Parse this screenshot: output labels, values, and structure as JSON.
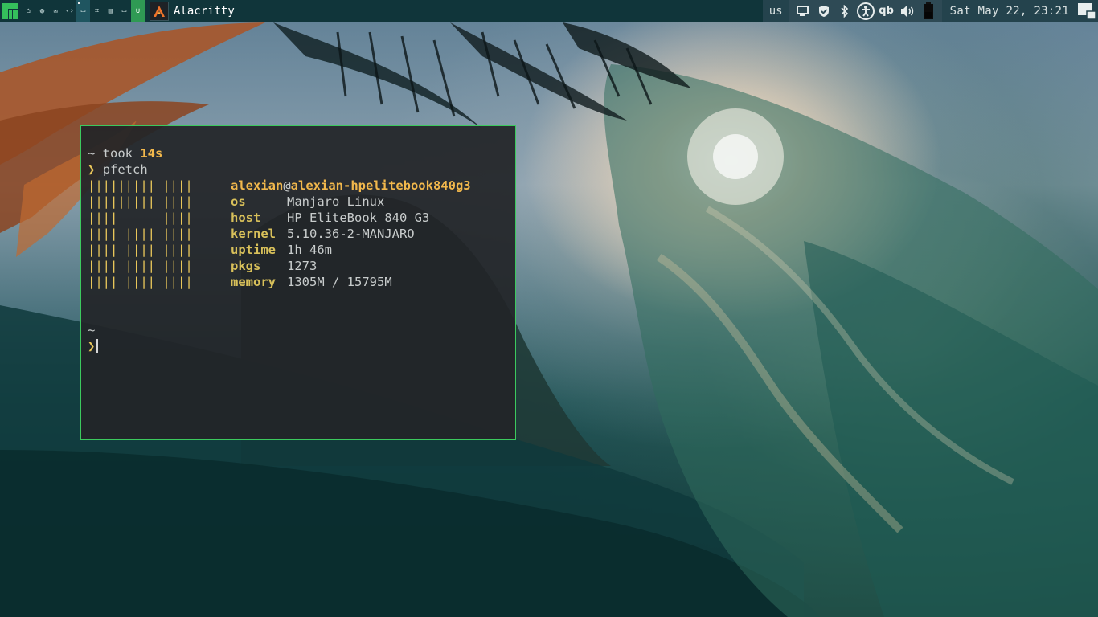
{
  "window_title": "Alacritty",
  "topbar": {
    "workspace_icons": [
      "home-icon",
      "globe-icon",
      "mail-icon",
      "code-icon",
      "desktop-icon",
      "crop-icon",
      "document-icon",
      "window-icon",
      "magnet-icon"
    ],
    "keyboard_layout": "us",
    "tray": [
      "screen-icon",
      "shield-check-icon",
      "bluetooth-icon",
      "accessibility-icon",
      "qbittorrent-icon",
      "volume-icon",
      "battery-icon"
    ],
    "qbittorrent_label": "qb",
    "clock": "Sat May 22, 23:21",
    "accent_color": "#35bf5c"
  },
  "terminal": {
    "line1_prefix": "~ took ",
    "line1_duration": "14s",
    "prompt_symbol": "❯",
    "command": "pfetch",
    "ascii_art": [
      "||||||||| ||||",
      "||||||||| ||||",
      "||||      ||||",
      "|||| |||| ||||",
      "|||| |||| ||||",
      "|||| |||| ||||",
      "|||| |||| ||||"
    ],
    "user": "alexian",
    "at": "@",
    "host": "alexian-hpelitebook840g3",
    "info": [
      {
        "label": "os",
        "value": "Manjaro Linux"
      },
      {
        "label": "host",
        "value": "HP EliteBook 840 G3"
      },
      {
        "label": "kernel",
        "value": "5.10.36-2-MANJARO"
      },
      {
        "label": "uptime",
        "value": "1h 46m"
      },
      {
        "label": "pkgs",
        "value": "1273"
      },
      {
        "label": "memory",
        "value": "1305M / 15795M"
      }
    ],
    "cwd": "~",
    "border_color": "#3cc95e"
  }
}
